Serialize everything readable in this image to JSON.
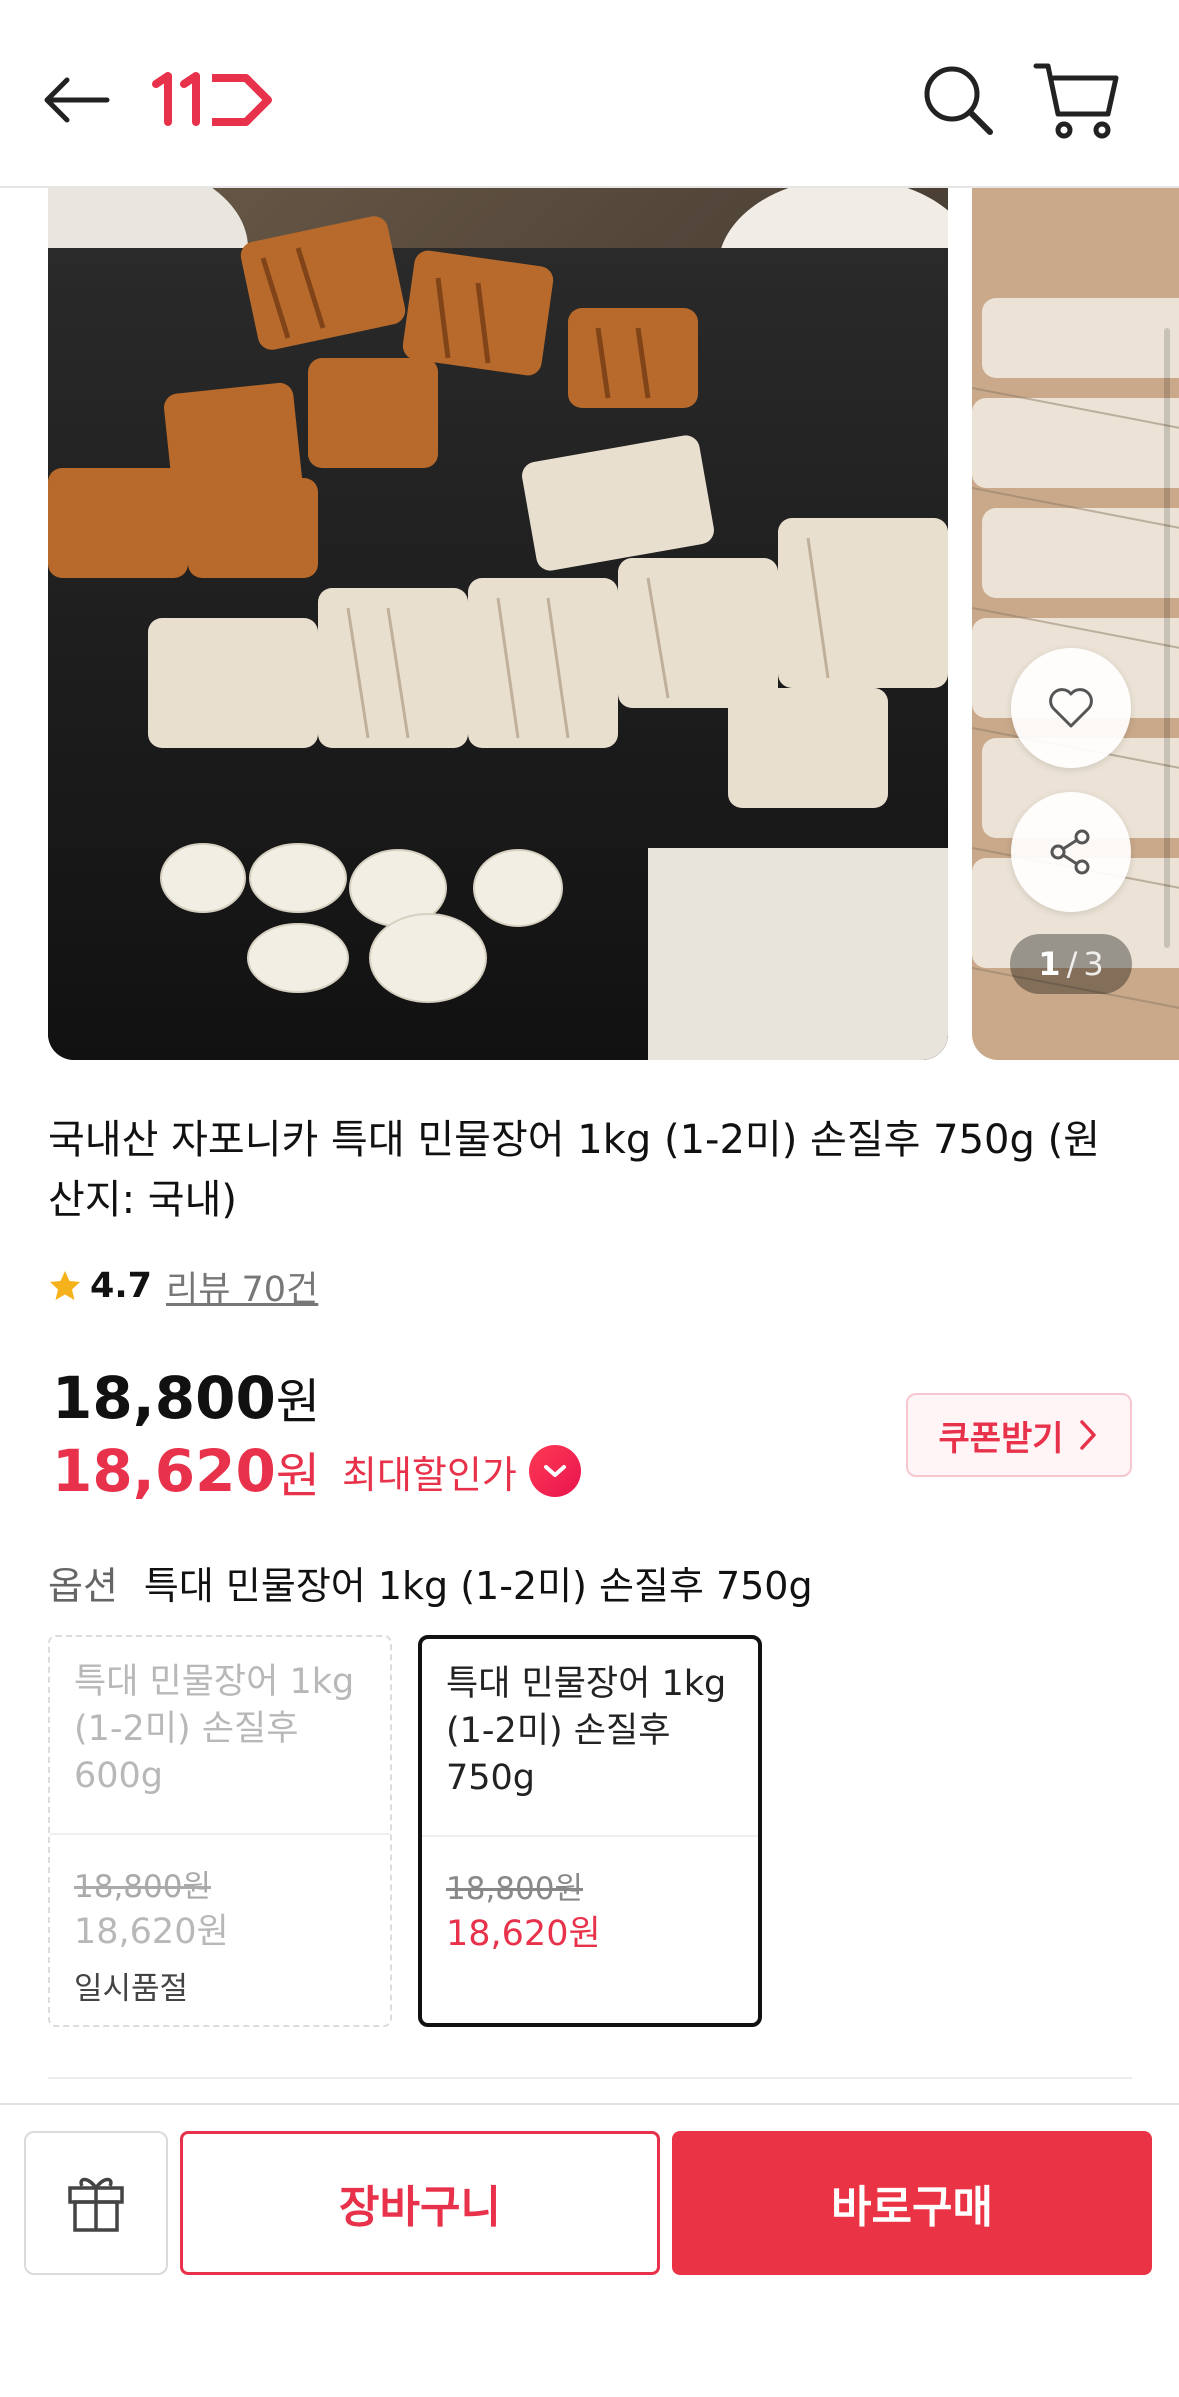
{
  "header": {
    "logo_text": "11",
    "brand_color": "#e8314a",
    "icons": [
      "back-arrow-icon",
      "search-icon",
      "cart-icon"
    ]
  },
  "gallery": {
    "pager_current": "1",
    "pager_separator": "/",
    "pager_total": "3",
    "icons": [
      "heart-icon",
      "share-icon"
    ]
  },
  "product": {
    "title": "국내산 자포니카 특대 민물장어 1kg (1-2미) 손질후 750g (원산지: 국내)",
    "rating_score": "4.7",
    "review_text": "리뷰 70건",
    "price_original_num": "18,800",
    "price_sale_num": "18,620",
    "currency": "원",
    "max_discount_label": "최대할인가",
    "coupon_label": "쿠폰받기",
    "accent_color": "#e8314a"
  },
  "options": {
    "label": "옵션",
    "selected_text": "특대 민물장어 1kg (1-2미) 손질후 750g",
    "items": [
      {
        "name": "특대 민물장어 1kg (1-2미) 손질후 600g",
        "price_original": "18,800원",
        "price_sale": "18,620원",
        "status": "일시품절"
      },
      {
        "name": "특대 민물장어 1kg (1-2미) 손질후 750g",
        "price_original": "18,800원",
        "price_sale": "18,620원",
        "status": ""
      }
    ]
  },
  "bottom_bar": {
    "cart_label": "장바구니",
    "buy_label": "바로구매",
    "icons": [
      "gift-icon"
    ]
  }
}
